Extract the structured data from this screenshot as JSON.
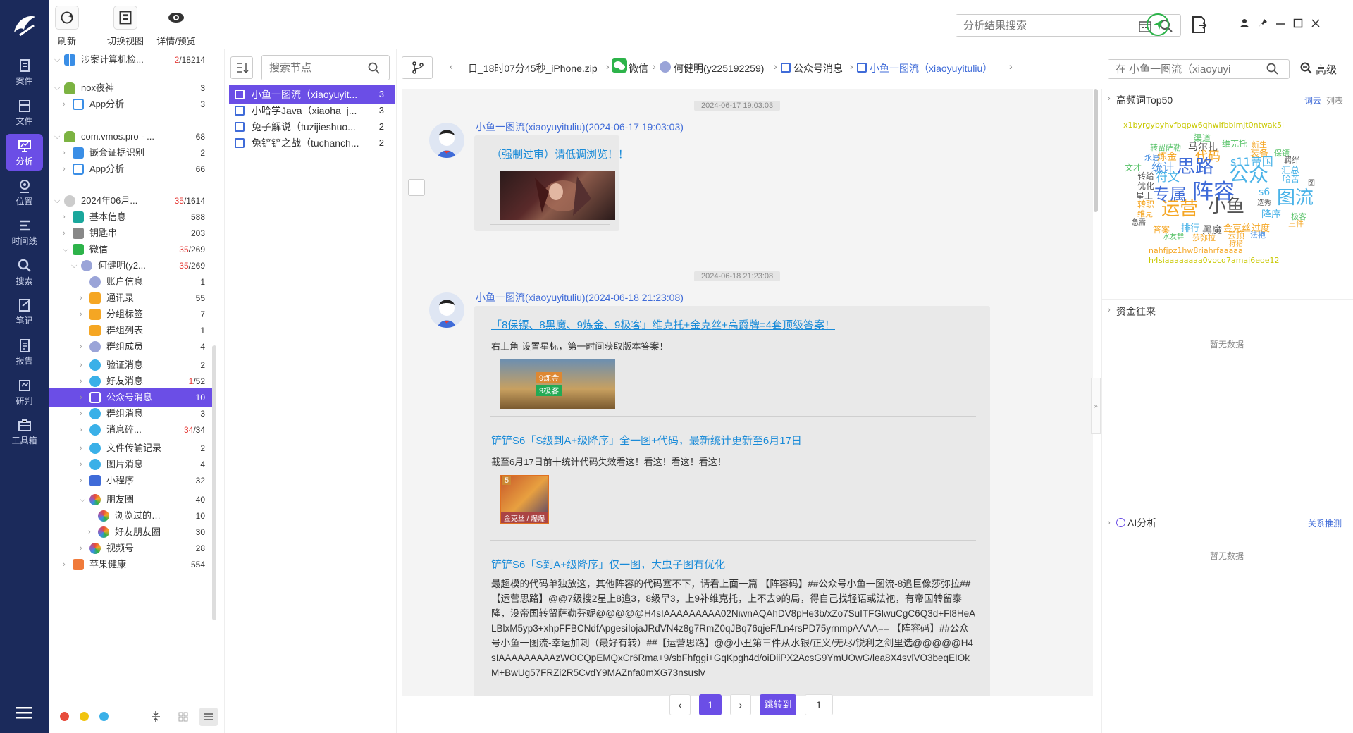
{
  "toolbar": {
    "refresh": "刷新",
    "switch_view": "切换视图",
    "detail_preview": "详情/预览",
    "search_placeholder": "分析结果搜索"
  },
  "nav": [
    {
      "label": "案件",
      "icon": "case-icon"
    },
    {
      "label": "文件",
      "icon": "folder-icon"
    },
    {
      "label": "分析",
      "icon": "analysis-icon",
      "active": true
    },
    {
      "label": "位置",
      "icon": "location-icon"
    },
    {
      "label": "时间线",
      "icon": "timeline-icon"
    },
    {
      "label": "搜索",
      "icon": "search-icon"
    },
    {
      "label": "笔记",
      "icon": "note-icon"
    },
    {
      "label": "报告",
      "icon": "report-icon"
    },
    {
      "label": "研判",
      "icon": "judge-icon"
    },
    {
      "label": "工具箱",
      "icon": "toolbox-icon"
    }
  ],
  "tree": [
    {
      "label": "涉案计算机检...",
      "count_red": "2",
      "count": "/18214"
    },
    {
      "label": "nox夜神",
      "count": "3"
    },
    {
      "label": "App分析",
      "count": "3"
    },
    {
      "label": "com.vmos.pro - ...",
      "count": "68"
    },
    {
      "label": "嵌套证据识别",
      "count": "2"
    },
    {
      "label": "App分析",
      "count": "66"
    },
    {
      "label": "2024年06月...",
      "count_red": "35",
      "count": "/1614"
    },
    {
      "label": "基本信息",
      "count": "588"
    },
    {
      "label": "钥匙串",
      "count": "203"
    },
    {
      "label": "微信",
      "count_red": "35",
      "count": "/269"
    },
    {
      "label": "何健明(y2...",
      "count_red": "35",
      "count": "/269"
    },
    {
      "label": "账户信息",
      "count": "1"
    },
    {
      "label": "通讯录",
      "count": "55"
    },
    {
      "label": "分组标签",
      "count": "7"
    },
    {
      "label": "群组列表",
      "count": "1"
    },
    {
      "label": "群组成员",
      "count": "4"
    },
    {
      "label": "验证消息",
      "count": "2"
    },
    {
      "label": "好友消息",
      "count_red": "1",
      "count": "/52"
    },
    {
      "label": "公众号消息",
      "count": "10"
    },
    {
      "label": "群组消息",
      "count": "3"
    },
    {
      "label": "消息碎...",
      "count_red": "34",
      "count": "/34"
    },
    {
      "label": "文件传输记录",
      "count": "2"
    },
    {
      "label": "图片消息",
      "count": "4"
    },
    {
      "label": "小程序",
      "count": "32"
    },
    {
      "label": "朋友圈",
      "count": "40"
    },
    {
      "label": "浏览过的朋...",
      "count": "10"
    },
    {
      "label": "好友朋友圈",
      "count": "30"
    },
    {
      "label": "视频号",
      "count": "28"
    },
    {
      "label": "苹果健康",
      "count": "554"
    }
  ],
  "nodes": {
    "search_placeholder": "搜索节点",
    "items": [
      {
        "label": "小鱼一图流（xiaoyuyit...",
        "count": "3"
      },
      {
        "label": "小哈学Java（xiaoha_j...",
        "count": "3"
      },
      {
        "label": "兔子解说（tuzijieshuo...",
        "count": "2"
      },
      {
        "label": "兔铲铲之战（tuchanch...",
        "count": "2"
      }
    ]
  },
  "breadcrumb": {
    "items": [
      "日_18时07分45秒_iPhone.zip",
      "微信",
      "何健明(y225192259)",
      "公众号消息",
      "小鱼一图流（xiaoyuyituliu）"
    ],
    "search_placeholder": "在 小鱼一图流（xiaoyuyi",
    "advanced": "高级"
  },
  "messages": [
    {
      "timestamp": "2024-06-17 19:03:03",
      "sender": "小鱼一图流(xiaoyuyituliu)(2024-06-17 19:03:03)",
      "articles": [
        {
          "title": "（强制过审）请低调浏览！！"
        }
      ]
    },
    {
      "timestamp": "2024-06-18 21:23:08",
      "sender": "小鱼一图流(xiaoyuyituliu)(2024-06-18 21:23:08)",
      "articles": [
        {
          "title": "「8保镖、8黑魔、9炼金、9极客」维克托+金克丝+高爵牌=4套顶级答案！",
          "desc": "右上角-设置星标，第一时间获取版本答案！",
          "thumb_text": [
            "9炼金",
            "9极客"
          ]
        },
        {
          "title": "铲铲S6「S级到A+级降序」全一图+代码，最新统计更新至6月17日",
          "desc": "截至6月17日前十统计代码失效看这！看这！看这！看这！",
          "thumb_text": [
            "5",
            "金克丝 / 爆爆"
          ]
        },
        {
          "title": "铲铲S6「S到A+级降序」仅一图，大虫子图有优化",
          "body": "最超模的代码单独放这，其他阵容的代码塞不下，请看上面一篇 【阵容码】##公众号小鱼一图流-8追巨像莎弥拉##【运营思路】@@7级搜2星上8追3，8级早3，上9补维克托，上不去9的局，得自己找轻语或法袍，有帝国转留泰隆，没帝国转留萨勒芬妮@@@@@H4sIAAAAAAAAA02NiwnAQAhDV8pHe3b/xZo7SuITFGlwuCgC6Q3d+Fl8HeALBlxM5yp3+xhpFFBCNdfApgesiIojaJRdVN4z8g7RmZ0qJBq76qjeF/Ln4rsPD75yrnmpAAAA== 【阵容码】##公众号小鱼一图流-幸运加刺（最好有转）##【运营思路】@@小丑第三件从水银/正义/无尽/锐利之剑里选@@@@@H4sIAAAAAAAAAzWOCQpEMQxCr6Rma+9/sbFhfggi+GqKpgh4d/oiDiiPX2AcsG9YmUOwG/lea8X4svlVO3beqEIOkM+BwUg57FRZi2R5CvdY9MAZnfa0mXG73nsuslv"
        }
      ]
    }
  ],
  "pagination": {
    "current": "1",
    "jump_label": "跳转到",
    "jump_value": "1"
  },
  "right_panel": {
    "wordcloud_title": "高频词Top50",
    "wordcloud_tab1": "词云",
    "wordcloud_tab2": "列表",
    "words": [
      {
        "t": "x1byrgybyhvfbqpw6qhwifbblmjt0ntwak5l",
        "c": "#c8c800",
        "s": 11
      },
      {
        "t": "渠道",
        "c": "#59c36a",
        "s": 12
      },
      {
        "t": "维克托",
        "c": "#59c36a",
        "s": 12
      },
      {
        "t": "新生",
        "c": "#f5a623",
        "s": 11
      },
      {
        "t": "转留萨勒",
        "c": "#59c36a",
        "s": 11
      },
      {
        "t": "马尔扎",
        "c": "#555",
        "s": 14
      },
      {
        "t": "装备",
        "c": "#f5a623",
        "s": 13
      },
      {
        "t": "保镖",
        "c": "#59c36a",
        "s": 11
      },
      {
        "t": "永恩",
        "c": "#4a90e2",
        "s": 11
      },
      {
        "t": "炼金",
        "c": "#f5a623",
        "s": 14
      },
      {
        "t": "代码",
        "c": "#f5a623",
        "s": 18
      },
      {
        "t": "s11帝国",
        "c": "#4ab3e8",
        "s": 16
      },
      {
        "t": "羁绊",
        "c": "#555",
        "s": 11
      },
      {
        "t": "文才",
        "c": "#59c36a",
        "s": 12
      },
      {
        "t": "统计",
        "c": "#4a90e2",
        "s": 16
      },
      {
        "t": "思路",
        "c": "#3f6bd8",
        "s": 26
      },
      {
        "t": "公众",
        "c": "#4ab3e8",
        "s": 28
      },
      {
        "t": "汇总",
        "c": "#4ab3e8",
        "s": 13
      },
      {
        "t": "转给",
        "c": "#555",
        "s": 12
      },
      {
        "t": "符文",
        "c": "#4ab3e8",
        "s": 17
      },
      {
        "t": "哈苦",
        "c": "#4ab3e8",
        "s": 12
      },
      {
        "t": "优化",
        "c": "#555",
        "s": 12
      },
      {
        "t": "图",
        "c": "#555",
        "s": 10
      },
      {
        "t": "星上",
        "c": "#555",
        "s": 12
      },
      {
        "t": "专属",
        "c": "#3f6bd8",
        "s": 24
      },
      {
        "t": "阵容",
        "c": "#3f6bd8",
        "s": 30
      },
      {
        "t": "s6",
        "c": "#4ab3e8",
        "s": 14
      },
      {
        "t": "图流",
        "c": "#4ab3e8",
        "s": 26
      },
      {
        "t": "转职",
        "c": "#f5a623",
        "s": 12
      },
      {
        "t": "选秀",
        "c": "#555",
        "s": 10
      },
      {
        "t": "维克",
        "c": "#f5a623",
        "s": 11
      },
      {
        "t": "运营",
        "c": "#f5a623",
        "s": 26
      },
      {
        "t": "小鱼",
        "c": "#555",
        "s": 26
      },
      {
        "t": "降序",
        "c": "#4ab3e8",
        "s": 14
      },
      {
        "t": "极客",
        "c": "#59c36a",
        "s": 11
      },
      {
        "t": "急需",
        "c": "#555",
        "s": 10
      },
      {
        "t": "三件",
        "c": "#f5a623",
        "s": 11
      },
      {
        "t": "答案",
        "c": "#f5a623",
        "s": 12
      },
      {
        "t": "排行",
        "c": "#4ab3e8",
        "s": 13
      },
      {
        "t": "黑魔",
        "c": "#555",
        "s": 14
      },
      {
        "t": "金克丝",
        "c": "#f5a623",
        "s": 13
      },
      {
        "t": "过度",
        "c": "#f5a623",
        "s": 13
      },
      {
        "t": "水友群",
        "c": "#59c36a",
        "s": 10
      },
      {
        "t": "莎弥拉",
        "c": "#f5a623",
        "s": 11
      },
      {
        "t": "云顶",
        "c": "#f5a623",
        "s": 12
      },
      {
        "t": "法袍",
        "c": "#4a90e2",
        "s": 11
      },
      {
        "t": "狩猎",
        "c": "#f5a623",
        "s": 10
      },
      {
        "t": "nahfjpz1hw8riahrfaaaaa",
        "c": "#f5a623",
        "s": 11
      },
      {
        "t": "h4siaaaaaaaa0vocq7amaj6eoe12",
        "c": "#c8c800",
        "s": 11
      }
    ],
    "funds_title": "资金往来",
    "no_data": "暂无数据",
    "ai_title": "AI分析",
    "ai_link": "关系推测"
  },
  "colors": {
    "accent": "#6b4ee6",
    "nav_bg": "#1b2a5b",
    "link": "#3f6bd8"
  }
}
